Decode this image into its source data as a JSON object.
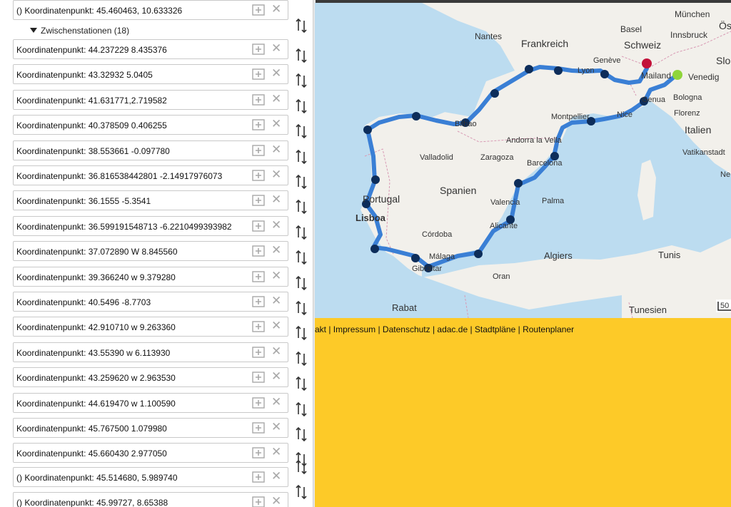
{
  "waypoints": {
    "start": {
      "prefix": "()",
      "label": "Koordinatenpunkt: 45.460463, 10.633326"
    },
    "group_label": "Zwischenstationen (18)",
    "intermediate": [
      "Koordinatenpunkt: 44.237229 8.435376",
      "Koordinatenpunkt: 43.32932 5.0405",
      "Koordinatenpunkt: 41.631771,2.719582",
      "Koordinatenpunkt: 40.378509 0.406255",
      "Koordinatenpunkt: 38.553661 -0.097780",
      "Koordinatenpunkt: 36.816538442801 -2.14917976073",
      "Koordinatenpunkt: 36.1555 -5.3541",
      "Koordinatenpunkt: 36.599191548713 -6.2210499393982",
      "Koordinatenpunkt: 37.072890 W 8.845560",
      "Koordinatenpunkt: 39.366240 w 9.379280",
      "Koordinatenpunkt: 40.5496 -8.7703",
      "Koordinatenpunkt: 42.910710 w 9.263360",
      "Koordinatenpunkt: 43.55390 w 6.113930",
      "Koordinatenpunkt: 43.259620 w 2.963530",
      "Koordinatenpunkt: 44.619470 w 1.100590",
      "Koordinatenpunkt: 45.767500 1.079980",
      "Koordinatenpunkt: 45.660430 2.977050"
    ],
    "after": [
      {
        "prefix": "()",
        "label": "Koordinatenpunkt: 45.514680, 5.989740"
      },
      {
        "prefix": "()",
        "label": "Koordinatenpunkt: 45.99727, 8.65388"
      }
    ]
  },
  "map": {
    "labels": {
      "muenchen": "München",
      "oest": "Öst",
      "basel": "Basel",
      "innsbruck": "Innsbruck",
      "nantes": "Nantes",
      "frankreich": "Frankreich",
      "schweiz": "Schweiz",
      "slo": "Slo",
      "geneve": "Genève",
      "lyon": "Lyon",
      "mailand": "Mailand",
      "venedig": "Venedig",
      "genua": "Genua",
      "bologna": "Bologna",
      "montpellier": "Montpellier",
      "nice": "Nice",
      "florenz": "Florenz",
      "bilbao": "Bilbao",
      "italien": "Italien",
      "andorra": "Andorra la Vella",
      "vatikan": "Vatikanstadt",
      "valladolid": "Valladolid",
      "zaragoza": "Zaragoza",
      "barcelona": "Barcelona",
      "ne": "Ne",
      "spanien": "Spanien",
      "portugal": "Portugal",
      "valencia": "Valencia",
      "palma": "Palma",
      "lisboa": "Lisboa",
      "alicante": "Alicante",
      "cordoba": "Córdoba",
      "malaga": "Málaga",
      "gibraltar": "Gibraltar",
      "algiers": "Algiers",
      "tunis": "Tunis",
      "oran": "Oran",
      "rabat": "Rabat",
      "tunesien": "Tunesien",
      "scale": "50"
    },
    "route_color": "#3a7fd5",
    "marker_color": "#0d2d5a",
    "start_marker_color": "#8fd53a",
    "end_marker_color": "#c3123a"
  },
  "footer": {
    "links": "akt | Impressum | Datenschutz | adac.de | Stadtpläne | Routenplaner",
    "background": "#fdca28"
  }
}
